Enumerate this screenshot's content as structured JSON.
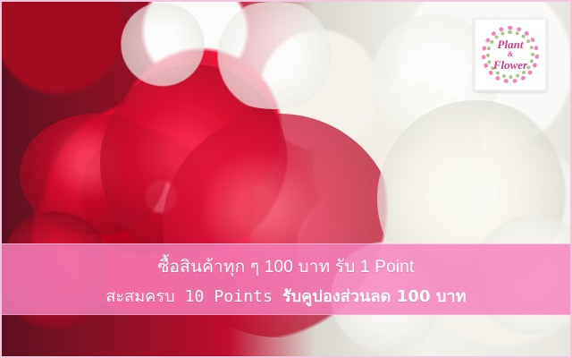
{
  "brand": {
    "logo_title": "Plant",
    "logo_connector": "&",
    "logo_subtitle": "Flower"
  },
  "promotion": {
    "line_1": "ซื้อสินค้าทุก ๆ 100 บาท รับ 1 Point",
    "line_2_part_a": "สะสมครบ 10 Points ",
    "line_2_part_b": "รับคูปองส่วนลด 100 บาท"
  },
  "colors": {
    "promo_band": "#f581be",
    "logo_pink": "#d13c89",
    "logo_green": "#9ec27c"
  }
}
